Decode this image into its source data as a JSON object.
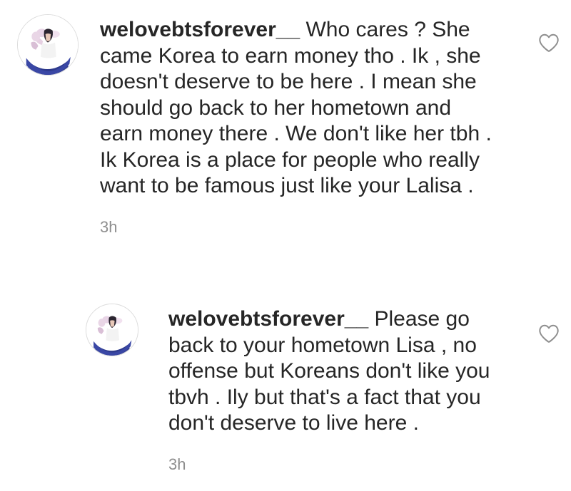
{
  "comments": [
    {
      "username": "welovebtsforever__",
      "text": "Who cares ? She came Korea to earn money tho . Ik , she doesn't deserve to be here . I mean she should go back to her hometown and earn money there . We don't like her tbh . Ik Korea is a place for people who really want to be famous just like your Lalisa .",
      "time": "3h",
      "like_icon": "heart-outline-icon"
    },
    {
      "username": "welovebtsforever__",
      "text": "Please go back to your hometown Lisa , no offense but Koreans don't like you tbvh . Ily but that's a fact that you don't deserve to live here .",
      "time": "3h",
      "like_icon": "heart-outline-icon"
    }
  ],
  "colors": {
    "text": "#262626",
    "meta": "#8e8e8e",
    "icon": "#8e8e8e"
  }
}
